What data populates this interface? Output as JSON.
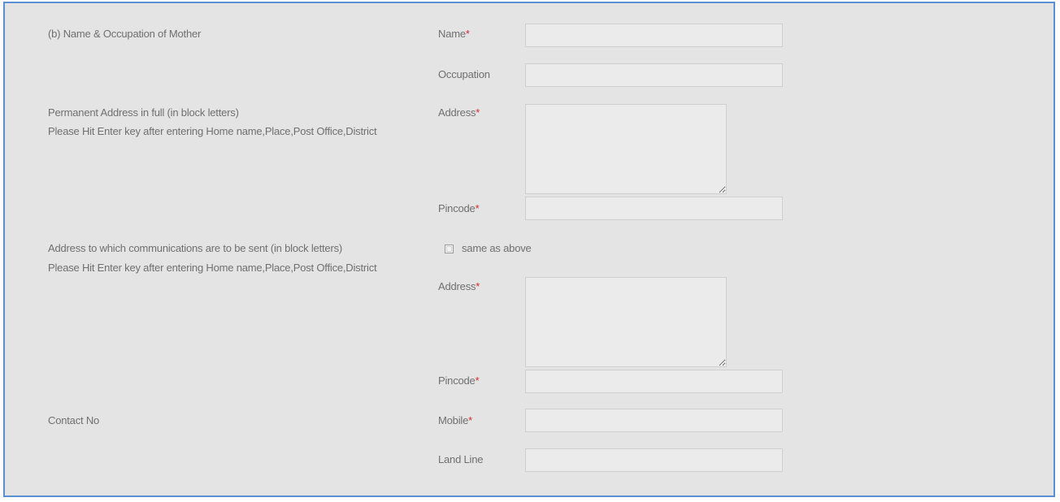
{
  "mother": {
    "section_label": "(b) Name & Occupation of Mother",
    "name_label": "Name",
    "name_value": "",
    "occupation_label": "Occupation",
    "occupation_value": ""
  },
  "permanent": {
    "section_label": "Permanent Address in full (in block letters)",
    "hint": "Please Hit Enter key after entering Home name,Place,Post Office,District",
    "address_label": "Address",
    "address_value": "",
    "pincode_label": "Pincode",
    "pincode_value": ""
  },
  "communication": {
    "section_label": "Address to which communications are to be sent (in block letters)",
    "hint": "Please Hit Enter key after entering Home name,Place,Post Office,District",
    "same_as_above_label": "same as above",
    "same_as_above_checked": false,
    "address_label": "Address",
    "address_value": "",
    "pincode_label": "Pincode",
    "pincode_value": ""
  },
  "contact": {
    "section_label": "Contact No",
    "mobile_label": "Mobile",
    "mobile_value": "",
    "landline_label": "Land Line",
    "landline_value": ""
  },
  "required_marker": "*",
  "colors": {
    "frame_border": "#5b8fd4",
    "panel_background": "#e4e4e4",
    "label_text": "#6f6f6f",
    "required_marker": "#d42a2a"
  }
}
